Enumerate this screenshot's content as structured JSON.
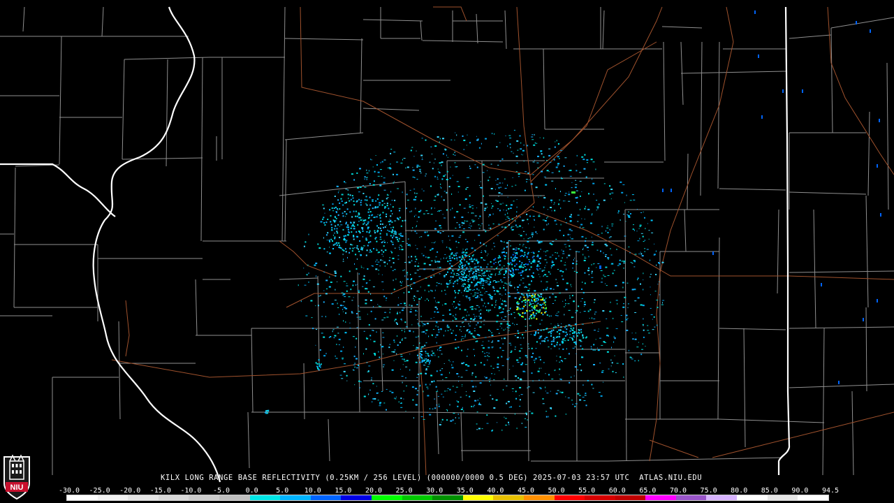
{
  "product": {
    "caption": "KILX LONG RANGE BASE REFLECTIVITY (0.25KM / 256 LEVEL) (000000/0000 0.5 DEG) 2025-07-03 23:57 UTC  ATLAS.NIU.EDU"
  },
  "logo": {
    "text": "NIU",
    "icon": "niu-tower-shield"
  },
  "colors": {
    "background": "#000000",
    "county_lines": "#8f8f8f",
    "state_lines": "#ffffff",
    "highways": "#a0522d",
    "logo_red": "#c8102e"
  },
  "legend": {
    "labels": [
      "-30.0",
      "-25.0",
      "-20.0",
      "-15.0",
      "-10.0",
      "-5.0",
      "0.0",
      "5.0",
      "10.0",
      "15.0",
      "20.0",
      "25.0",
      "30.0",
      "35.0",
      "40.0",
      "45.0",
      "50.0",
      "55.0",
      "60.0",
      "65.0",
      "70.0",
      "75.0",
      "80.0",
      "85.0",
      "90.0",
      "94.5"
    ],
    "colors": [
      "#ffffff",
      "#f2f2f2",
      "#e5e5e5",
      "#d8d8d8",
      "#cccccc",
      "#bfbfbf",
      "#00e6e6",
      "#00b4ff",
      "#0064ff",
      "#0000e6",
      "#00ff00",
      "#00c800",
      "#009100",
      "#ffff00",
      "#e7c000",
      "#ff9000",
      "#ff0000",
      "#d60000",
      "#c00000",
      "#ff00ff",
      "#9955c9",
      "#d8b4ff",
      "#ffffff",
      "#e6e6e6",
      "#ffffff"
    ]
  }
}
